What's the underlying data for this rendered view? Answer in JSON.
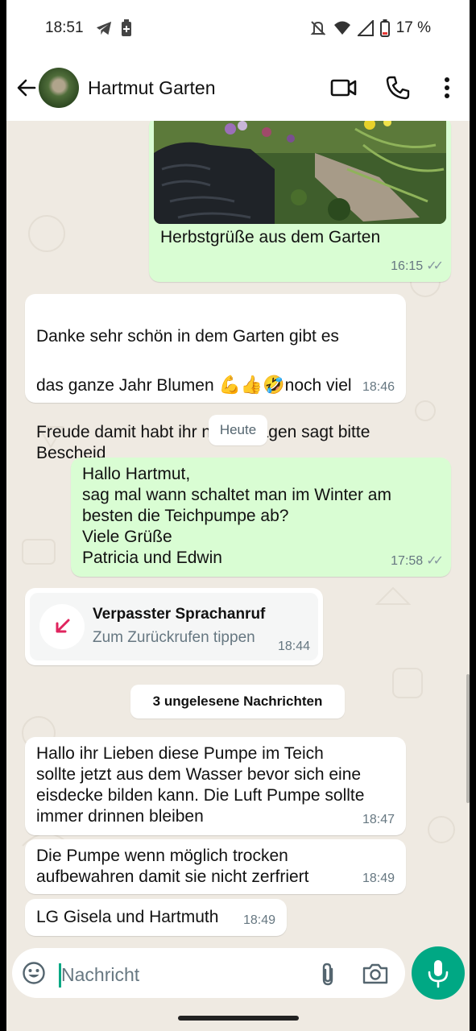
{
  "statusbar": {
    "time": "18:51",
    "battery": "17 %",
    "icons": [
      "telegram-icon",
      "battery-saver-icon",
      "mute-icon",
      "wifi-icon",
      "signal-icon",
      "battery-icon"
    ]
  },
  "header": {
    "contact_name": "Hartmut Garten",
    "actions": [
      "video-call-icon",
      "voice-call-icon",
      "more-icon"
    ]
  },
  "messages": [
    {
      "direction": "out",
      "has_image": true,
      "text": "Herbstgrüße aus dem Garten",
      "time": "16:15",
      "status": "read"
    },
    {
      "direction": "in",
      "text_line1": "Danke sehr schön in dem Garten gibt es",
      "text_line2_before": "das ganze Jahr Blumen ",
      "emojis": "💪👍🤣",
      "text_line2_after": "noch viel",
      "text_rest": "Freude damit habt ihr noch Fragen sagt bitte\nBescheid",
      "time": "18:46"
    },
    {
      "direction": "out",
      "text": "Hallo Hartmut,\n sag mal wann schaltet man im Winter am\nbesten die Teichpumpe ab?\nViele Grüße\nPatricia und Edwin",
      "time": "17:58",
      "status": "read"
    },
    {
      "direction": "in",
      "text": "Hallo ihr Lieben diese Pumpe im Teich\nsollte jetzt aus dem Wasser bevor sich eine\neisdecke bilden kann. Die Luft Pumpe sollte\nimmer drinnen bleiben",
      "time": "18:47"
    },
    {
      "direction": "in",
      "text": "Die Pumpe wenn möglich trocken\naufbewahren damit sie nicht zerfriert",
      "time": "18:49"
    },
    {
      "direction": "in",
      "text": "LG Gisela und Hartmuth",
      "time": "18:49"
    }
  ],
  "date_chip": "Heute",
  "missed_call": {
    "title": "Verpasster Sprachanruf",
    "subtitle": "Zum Zurückrufen tippen",
    "time": "18:44",
    "icon": "missed-call-icon"
  },
  "unread_chip": "3 ungelesene Nachrichten",
  "composer": {
    "placeholder": "Nachricht",
    "icons": [
      "emoji-icon",
      "attach-icon",
      "camera-icon",
      "mic-icon"
    ]
  },
  "colors": {
    "outgoing": "#d9fdd3",
    "incoming": "#ffffff",
    "accent": "#00a884",
    "background": "#efeae2",
    "missed_call": "#e0245e"
  }
}
